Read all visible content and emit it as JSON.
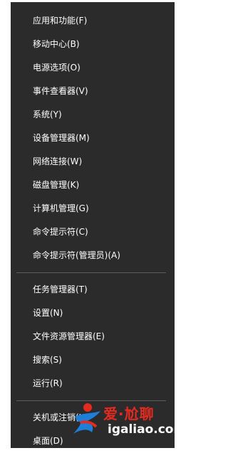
{
  "menu": {
    "group1": [
      {
        "label": "应用和功能(F)"
      },
      {
        "label": "移动中心(B)"
      },
      {
        "label": "电源选项(O)"
      },
      {
        "label": "事件查看器(V)"
      },
      {
        "label": "系统(Y)"
      },
      {
        "label": "设备管理器(M)"
      },
      {
        "label": "网络连接(W)"
      },
      {
        "label": "磁盘管理(K)"
      },
      {
        "label": "计算机管理(G)"
      },
      {
        "label": "命令提示符(C)"
      },
      {
        "label": "命令提示符(管理员)(A)"
      }
    ],
    "group2": [
      {
        "label": "任务管理器(T)"
      },
      {
        "label": "设置(N)"
      },
      {
        "label": "文件资源管理器(E)"
      },
      {
        "label": "搜索(S)"
      },
      {
        "label": "运行(R)"
      }
    ],
    "group3": [
      {
        "label": "关机或注销(U)"
      },
      {
        "label": "桌面(D)"
      }
    ]
  },
  "watermark": {
    "line1": "爱·尬聊",
    "line2": "igaliao.com"
  },
  "colors": {
    "menu_bg": "#2b2b2b",
    "text": "#ffffff",
    "separator": "#5e5e5e",
    "watermark_red": "#e52a20"
  }
}
